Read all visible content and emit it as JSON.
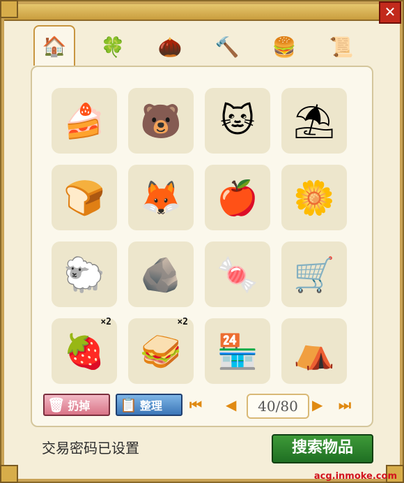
{
  "tabs": [
    {
      "icon": "house-icon",
      "glyph": "🏠",
      "active": true
    },
    {
      "icon": "clover-icon",
      "glyph": "🍀",
      "active": false
    },
    {
      "icon": "coconut-icon",
      "glyph": "🌰",
      "active": false
    },
    {
      "icon": "hammer-icon",
      "glyph": "🔨",
      "active": false
    },
    {
      "icon": "burger-icon",
      "glyph": "🍔",
      "active": false
    },
    {
      "icon": "scroll-icon",
      "glyph": "📜",
      "active": false
    }
  ],
  "items": [
    {
      "icon": "cake-slice-icon",
      "glyph": "🍰",
      "qty": ""
    },
    {
      "icon": "bear-eating-icon",
      "glyph": "🐻",
      "qty": ""
    },
    {
      "icon": "white-cat-icon",
      "glyph": "🐱",
      "qty": ""
    },
    {
      "icon": "parasol-table-icon",
      "glyph": "⛱",
      "qty": ""
    },
    {
      "icon": "toast-icon",
      "glyph": "🍞",
      "qty": ""
    },
    {
      "icon": "sleeping-cat-icon",
      "glyph": "🦊",
      "qty": ""
    },
    {
      "icon": "fruit-pile-icon",
      "glyph": "🍎",
      "qty": ""
    },
    {
      "icon": "flower-planter-icon",
      "glyph": "🌼",
      "qty": ""
    },
    {
      "icon": "sheep-leaf-icon",
      "glyph": "🐑",
      "qty": ""
    },
    {
      "icon": "pink-rock-icon",
      "glyph": "🪨",
      "qty": ""
    },
    {
      "icon": "candy-icon",
      "glyph": "🍬",
      "qty": ""
    },
    {
      "icon": "cash-register-icon",
      "glyph": "🛒",
      "qty": ""
    },
    {
      "icon": "strawberry-icon",
      "glyph": "🍓",
      "qty": "×2"
    },
    {
      "icon": "sandwich-plate-icon",
      "glyph": "🥪",
      "qty": "×2"
    },
    {
      "icon": "market-stall-icon",
      "glyph": "🏪",
      "qty": ""
    },
    {
      "icon": "tent-icon",
      "glyph": "⛺",
      "qty": ""
    }
  ],
  "toolbar": {
    "discard_label": "扔掉",
    "sort_label": "整理"
  },
  "pager": {
    "text": "40/80",
    "first": "⏮",
    "prev": "◀",
    "next": "▶",
    "last": "⏭"
  },
  "status": "交易密码已设置",
  "search_button": "搜索物品",
  "watermark": "acg.inmoke.com",
  "close_glyph": "✕"
}
